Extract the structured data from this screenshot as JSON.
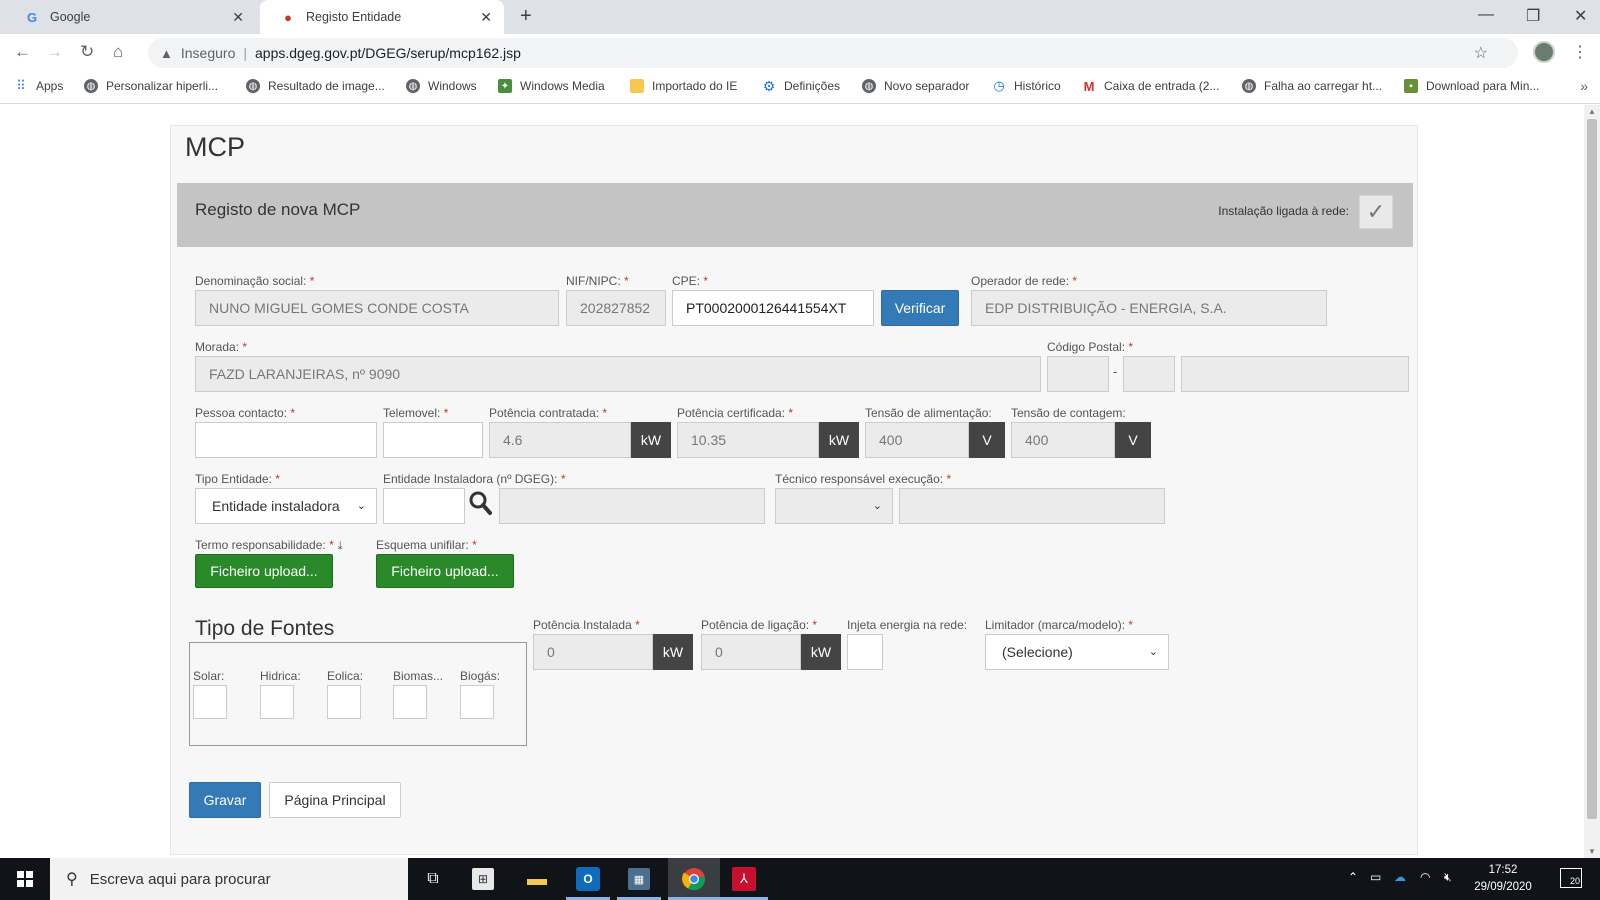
{
  "browser": {
    "tabs": [
      {
        "title": "Google",
        "favicon": "google-g-icon",
        "active": false
      },
      {
        "title": "Registo Entidade",
        "favicon": "site-icon",
        "active": true
      }
    ],
    "insecure_label": "Inseguro",
    "url": "apps.dgeg.gov.pt/DGEG/serup/mcp162.jsp",
    "bookmarks": [
      {
        "label": "Apps",
        "icon": "apps-grid-icon"
      },
      {
        "label": "Personalizar hiperli...",
        "icon": "globe-icon"
      },
      {
        "label": "Resultado de image...",
        "icon": "globe-icon"
      },
      {
        "label": "Windows",
        "icon": "globe-icon"
      },
      {
        "label": "Windows Media",
        "icon": "windows-media-icon"
      },
      {
        "label": "Importado do IE",
        "icon": "folder-icon"
      },
      {
        "label": "Definições",
        "icon": "gear-icon"
      },
      {
        "label": "Novo separador",
        "icon": "globe-icon"
      },
      {
        "label": "Histórico",
        "icon": "history-icon"
      },
      {
        "label": "Caixa de entrada (2...",
        "icon": "gmail-icon"
      },
      {
        "label": "Falha ao carregar ht...",
        "icon": "globe-icon"
      },
      {
        "label": "Download para Min...",
        "icon": "package-icon"
      }
    ]
  },
  "form": {
    "page_title": "MCP",
    "panel_title": "Registo de nova MCP",
    "net_label": "Instalação ligada à rede:",
    "net_checked": "✓",
    "fields": {
      "denominacao": {
        "label": "Denominação social:",
        "value": "NUNO MIGUEL GOMES CONDE COSTA"
      },
      "nif": {
        "label": "NIF/NIPC:",
        "value": "202827852"
      },
      "cpe": {
        "label": "CPE:",
        "value": "PT0002000126441554XT"
      },
      "verificar": "Verificar",
      "operador": {
        "label": "Operador de rede:",
        "value": "EDP DISTRIBUIÇÃO - ENERGIA, S.A."
      },
      "morada": {
        "label": "Morada:",
        "value": "FAZD LARANJEIRAS, nº 9090"
      },
      "codigo_postal": {
        "label": "Código Postal:",
        "dash": "-"
      },
      "pessoa": {
        "label": "Pessoa contacto:"
      },
      "telemovel": {
        "label": "Telemovel:"
      },
      "pot_contratada": {
        "label": "Potência contratada:",
        "value": "4.6",
        "unit": "kW"
      },
      "pot_certificada": {
        "label": "Potência certificada:",
        "value": "10.35",
        "unit": "kW"
      },
      "tensao_alim": {
        "label": "Tensão de alimentação:",
        "value": "400",
        "unit": "V"
      },
      "tensao_cont": {
        "label": "Tensão de contagem:",
        "value": "400",
        "unit": "V"
      },
      "tipo_entidade": {
        "label": "Tipo Entidade:",
        "value": "Entidade instaladora"
      },
      "entidade_instaladora": {
        "label": "Entidade Instaladora (nº DGEG):"
      },
      "tecnico": {
        "label": "Técnico responsável execução:"
      },
      "termo": {
        "label": "Termo responsabilidade:",
        "button": "Ficheiro upload..."
      },
      "esquema": {
        "label": "Esquema unifilar:",
        "button": "Ficheiro upload..."
      }
    },
    "req_mark": "*",
    "fontes": {
      "legend": "Tipo de Fontes",
      "types": [
        "Solar:",
        "Hidrica:",
        "Eolica:",
        "Biomas...",
        "Biogás:"
      ]
    },
    "pot_instalada": {
      "label": "Potência Instalada",
      "value": "0",
      "unit": "kW"
    },
    "pot_ligacao": {
      "label": "Potência de ligação:",
      "value": "0",
      "unit": "kW"
    },
    "injeta": {
      "label": "Injeta energia na rede:"
    },
    "limitador": {
      "label": "Limitador (marca/modelo):",
      "value": "(Selecione)"
    },
    "buttons": {
      "gravar": "Gravar",
      "principal": "Página Principal"
    }
  },
  "taskbar": {
    "search_placeholder": "Escreva aqui para procurar",
    "time": "17:52",
    "date": "29/09/2020",
    "notifications": "20"
  },
  "colors": {
    "primary_button": "#337ab7",
    "upload_button": "#2a8a2a",
    "panel_header": "#c4c4c4",
    "unit_badge": "#444444"
  }
}
